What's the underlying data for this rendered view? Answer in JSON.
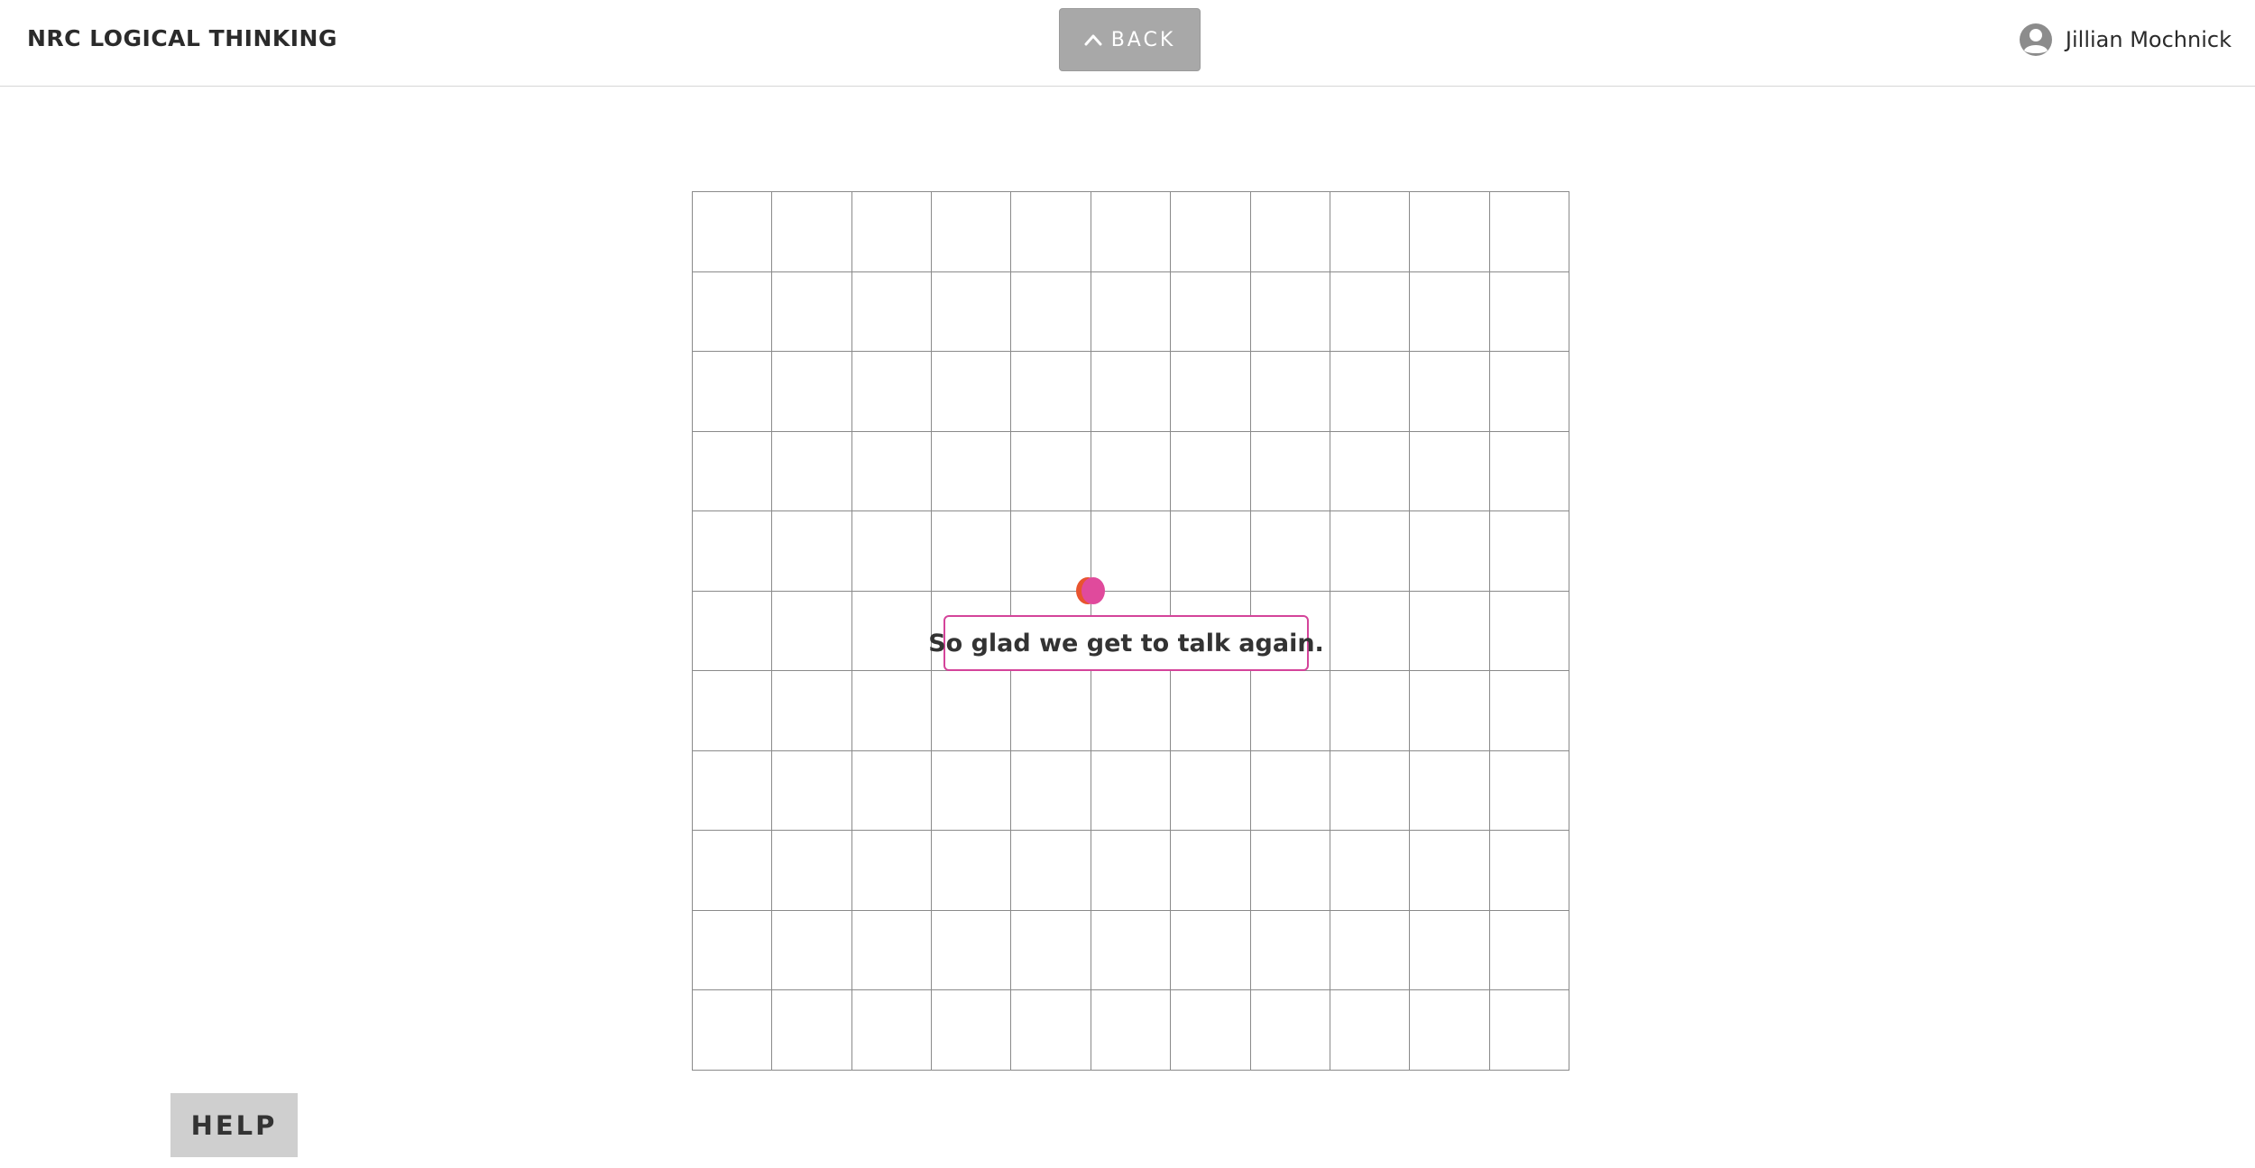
{
  "header": {
    "app_title": "NRC LOGICAL THINKING",
    "back_label": "BACK",
    "user_name": "Jillian Mochnick"
  },
  "board": {
    "rows": 11,
    "columns": 11
  },
  "speech": {
    "text": "So glad we get to talk again."
  },
  "help_label": "HELP",
  "icons": {
    "back": "chevron-up-icon",
    "user": "user-avatar-icon",
    "agent": "agent-character-icon"
  },
  "colors": {
    "back_button": "#a8a8a8",
    "help_button": "#cfcfcf",
    "grid_line": "#8a8a8a",
    "bubble_border": "#d4449a",
    "agent_left": "#e8542f",
    "agent_right": "#e04a9c"
  }
}
